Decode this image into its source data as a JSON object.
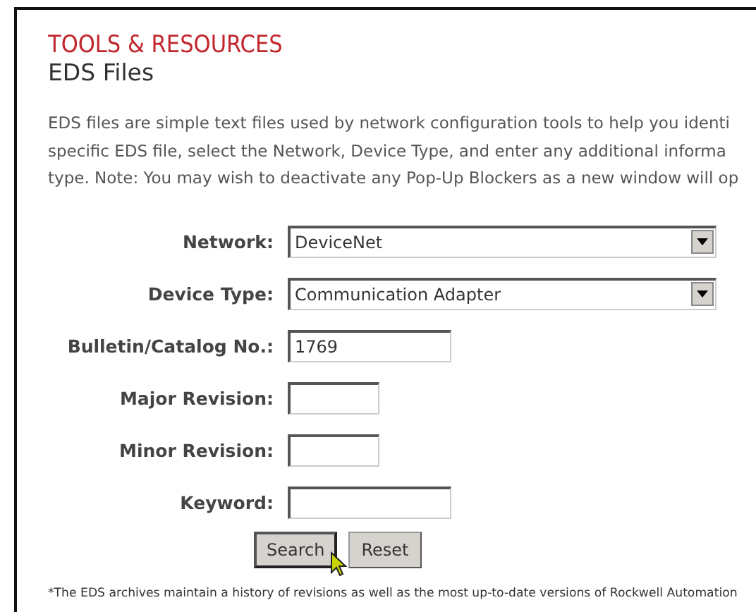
{
  "header": {
    "section": "TOOLS & RESOURCES",
    "title": "EDS Files"
  },
  "description": [
    "EDS files are simple text files used by network configuration tools to help you identi",
    "specific EDS file, select the Network, Device Type, and enter any additional informa",
    "type. Note: You may wish to deactivate any Pop-Up Blockers as a new window will op"
  ],
  "form": {
    "fields": [
      {
        "kind": "select",
        "label": "Network:",
        "value": "DeviceNet"
      },
      {
        "kind": "select",
        "label": "Device Type:",
        "value": "Communication Adapter"
      },
      {
        "kind": "input",
        "label": "Bulletin/Catalog No.:",
        "value": "1769"
      },
      {
        "kind": "short-input",
        "label": "Major Revision:"
      },
      {
        "kind": "short-input",
        "label": "Minor Revision:"
      },
      {
        "kind": "input",
        "label": "Keyword:"
      }
    ],
    "buttons": [
      {
        "label": "Search",
        "focused": true
      },
      {
        "label": "Reset",
        "focused": false
      }
    ]
  },
  "footnote": "*The EDS archives maintain a history of revisions as well as the most up-to-date versions of Rockwell Automation"
}
